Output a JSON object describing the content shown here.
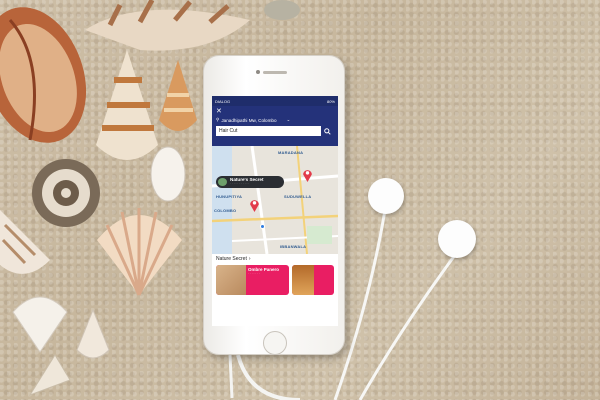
{
  "status_bar": {
    "carrier": "DIALOG",
    "battery": "80%"
  },
  "header": {
    "close_icon": "close-icon",
    "location": "Janadhipathi Mw, Colombo",
    "search_value": "Hair Cut",
    "search_icon": "search-icon"
  },
  "map": {
    "labels": [
      "MARADANA",
      "HUNUPITIYA",
      "SUDUWELLA",
      "COLOMBO",
      "IBBANWALA"
    ],
    "callout": {
      "title": "Nature's Secret"
    }
  },
  "section": {
    "title": "Nature Secret"
  },
  "cards": [
    {
      "title": "Ombre Panero"
    }
  ],
  "colors": {
    "brand": "#24327a",
    "card": "#e91e63",
    "pin": "#e23a4a"
  }
}
